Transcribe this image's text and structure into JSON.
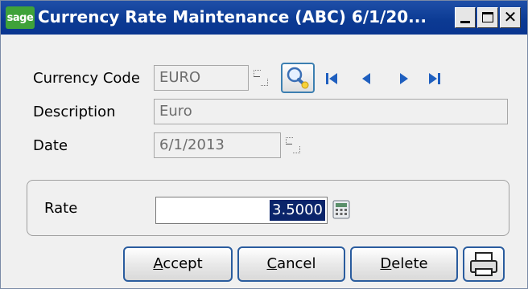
{
  "window": {
    "logo_text": "sage",
    "title": "Currency Rate Maintenance (ABC) 6/1/20...",
    "min_label": "",
    "max_label": "",
    "close_label": "✕"
  },
  "form": {
    "currency_code": {
      "label": "Currency Code",
      "value": "EURO"
    },
    "description": {
      "label": "Description",
      "value": "Euro"
    },
    "date": {
      "label": "Date",
      "value": "6/1/2013"
    },
    "rate": {
      "label": "Rate",
      "value": "3.5000"
    }
  },
  "icons": {
    "lookup": "lookup-icon",
    "search": "search-icon",
    "first": "first-record-icon",
    "prev": "previous-record-icon",
    "next": "next-record-icon",
    "last": "last-record-icon",
    "calculator": "calculator-icon",
    "printer": "printer-icon"
  },
  "buttons": {
    "accept": {
      "first": "A",
      "rest": "ccept"
    },
    "cancel": {
      "first": "C",
      "rest": "ancel"
    },
    "delete": {
      "first": "D",
      "rest": "elete"
    }
  },
  "colors": {
    "titlebar": "#0b3a93",
    "sage_green": "#3fa23a",
    "button_border": "#2a5c9e",
    "nav_arrow": "#1f5fbf",
    "selection": "#0a246a"
  }
}
